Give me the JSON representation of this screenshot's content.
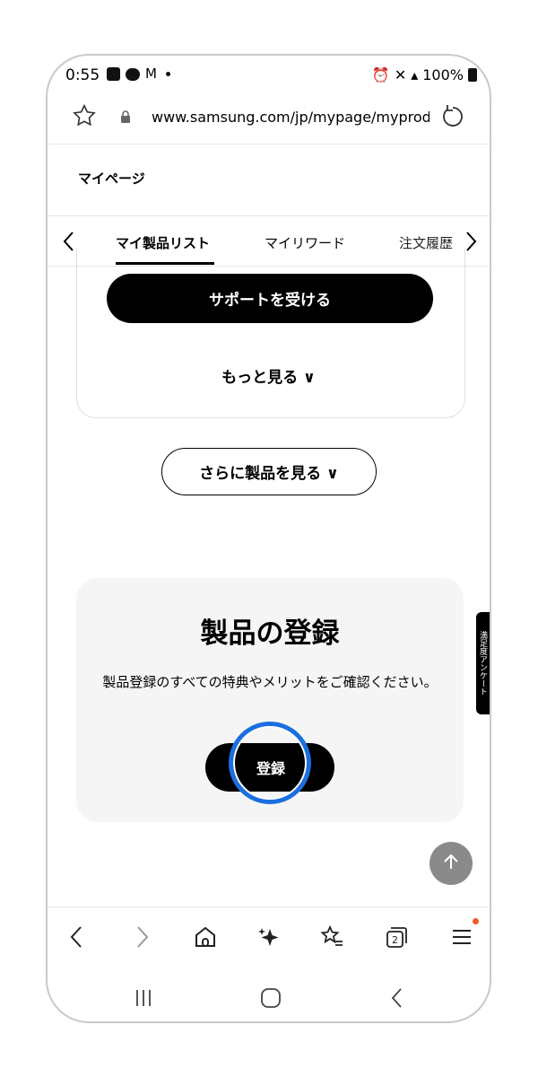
{
  "status_bar": {
    "time": "0:55",
    "battery": "100%"
  },
  "browser": {
    "url": "www.samsung.com/jp/mypage/myprod"
  },
  "page": {
    "header_title": "マイページ",
    "tabs": [
      {
        "label": "マイ製品リスト"
      },
      {
        "label": "マイリワード"
      },
      {
        "label": "注文履歴"
      }
    ],
    "support_button": "サポートを受ける",
    "more_link": "もっと見る ∨",
    "more_products_button": "さらに製品を見る ∨",
    "registration": {
      "title": "製品の登録",
      "description": "製品登録のすべての特典やメリットをご確認ください。",
      "button": "登録"
    },
    "survey_tab": "満足度アンケート"
  },
  "icons": {
    "scroll_top": "arrow-up-icon",
    "toolbar": [
      "back-icon",
      "forward-icon",
      "home-icon",
      "sparkle-icon",
      "bookmarks-icon",
      "tabs-icon",
      "menu-icon"
    ],
    "tab_count": "2"
  },
  "colors": {
    "focus_ring": "#1a6fe0",
    "notification_dot": "#f05a28"
  }
}
